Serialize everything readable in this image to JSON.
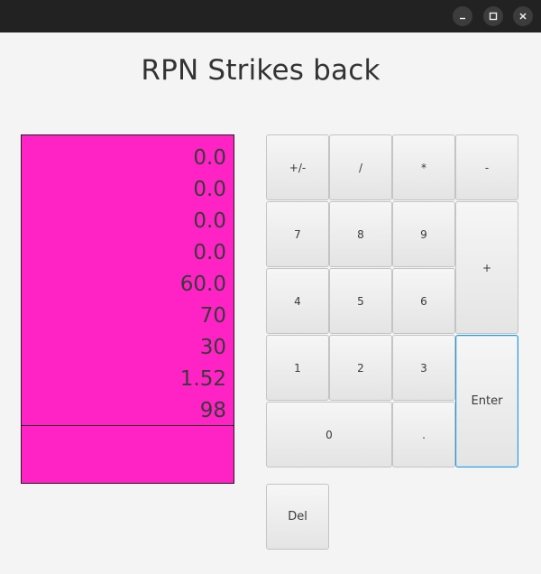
{
  "window": {
    "controls": {
      "minimize_icon": "minimize-icon",
      "maximize_icon": "maximize-icon",
      "close_icon": "close-icon"
    }
  },
  "app": {
    "title": "RPN Strikes back"
  },
  "stack": {
    "background": "#ff22c5",
    "values": [
      "0.0",
      "0.0",
      "0.0",
      "0.0",
      "60.0",
      "70",
      "30",
      "1.52",
      "98"
    ],
    "input": ""
  },
  "keypad": {
    "negate": "+/-",
    "divide": "/",
    "multiply": "*",
    "subtract": "-",
    "seven": "7",
    "eight": "8",
    "nine": "9",
    "add": "+",
    "four": "4",
    "five": "5",
    "six": "6",
    "one": "1",
    "two": "2",
    "three": "3",
    "enter": "Enter",
    "zero": "0",
    "decimal": ".",
    "delete": "Del"
  }
}
